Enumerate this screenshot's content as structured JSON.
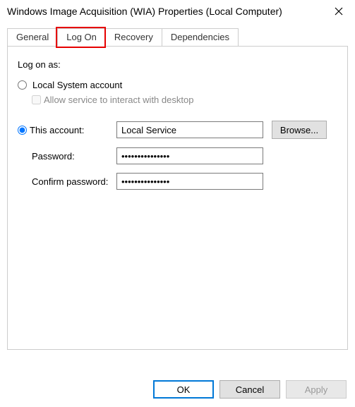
{
  "window": {
    "title": "Windows Image Acquisition (WIA) Properties (Local Computer)"
  },
  "tabs": {
    "general": "General",
    "logon": "Log On",
    "recovery": "Recovery",
    "dependencies": "Dependencies",
    "active": "logon"
  },
  "logon": {
    "section_label": "Log on as:",
    "local_system_label": "Local System account",
    "interact_label": "Allow service to interact with desktop",
    "this_account_label": "This account:",
    "account_value": "Local Service",
    "browse_label": "Browse...",
    "password_label": "Password:",
    "password_value": "•••••••••••••••",
    "confirm_label": "Confirm password:",
    "confirm_value": "•••••••••••••••"
  },
  "buttons": {
    "ok": "OK",
    "cancel": "Cancel",
    "apply": "Apply"
  },
  "highlight": {
    "tab": "logon"
  }
}
